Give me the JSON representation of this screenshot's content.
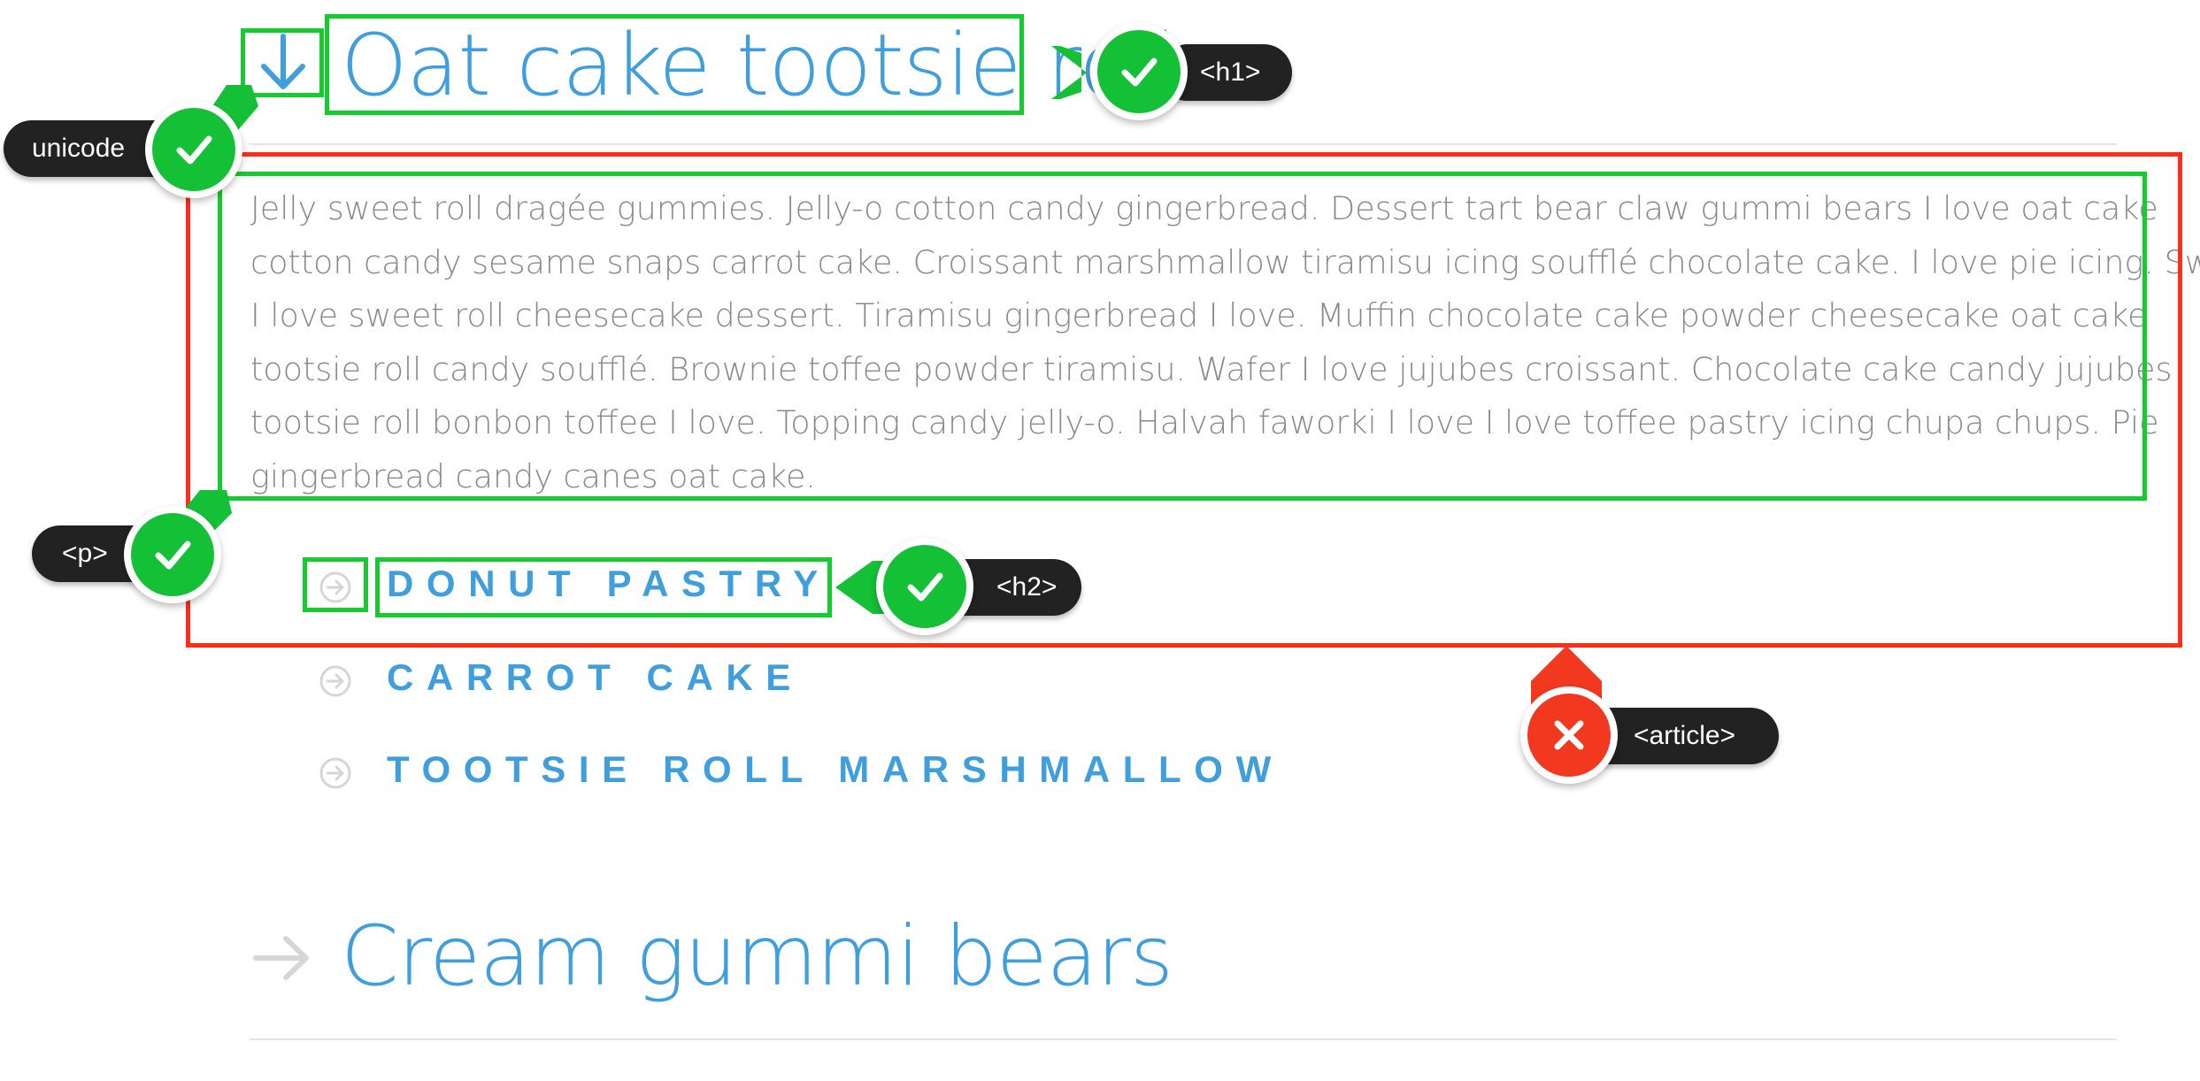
{
  "section1": {
    "title": "Oat cake tootsie roll",
    "arrow_icon": "down-arrow-icon",
    "paragraph_lines": [
      "Jelly sweet roll dragée gummies. Jelly-o cotton candy gingerbread. Dessert tart bear claw gummi bears I love oat cake",
      "cotton candy sesame snaps carrot cake. Croissant marshmallow tiramisu icing soufflé chocolate cake. I love pie icing. Sweet",
      "I love sweet roll cheesecake dessert. Tiramisu gingerbread I love. Muffin chocolate cake powder cheesecake oat cake",
      "tootsie roll candy soufflé. Brownie toffee powder tiramisu. Wafer I love jujubes croissant. Chocolate cake candy jujubes",
      "tootsie roll bonbon toffee I love. Topping candy jelly-o. Halvah faworki I love I love toffee pastry icing chupa chups. Pie",
      "gingerbread candy canes oat cake."
    ],
    "subheadings": [
      "DONUT PASTRY",
      "CARROT CAKE",
      "TOOTSIE ROLL MARSHMALLOW"
    ],
    "subheading_icon": "circle-arrow-right-icon"
  },
  "section2": {
    "title": "Cream gummi bears",
    "arrow_icon": "right-arrow-icon"
  },
  "annotations": {
    "h1": "<h1>",
    "unicode": "unicode",
    "p": "<p>",
    "h2": "<h2>",
    "article": "<article>"
  },
  "colors": {
    "heading_blue": "#3f9edd",
    "body_gray": "#8a8a8a",
    "pass_green": "#14cc2d",
    "fail_red": "#ff2d1a",
    "badge_dark": "#222222"
  }
}
